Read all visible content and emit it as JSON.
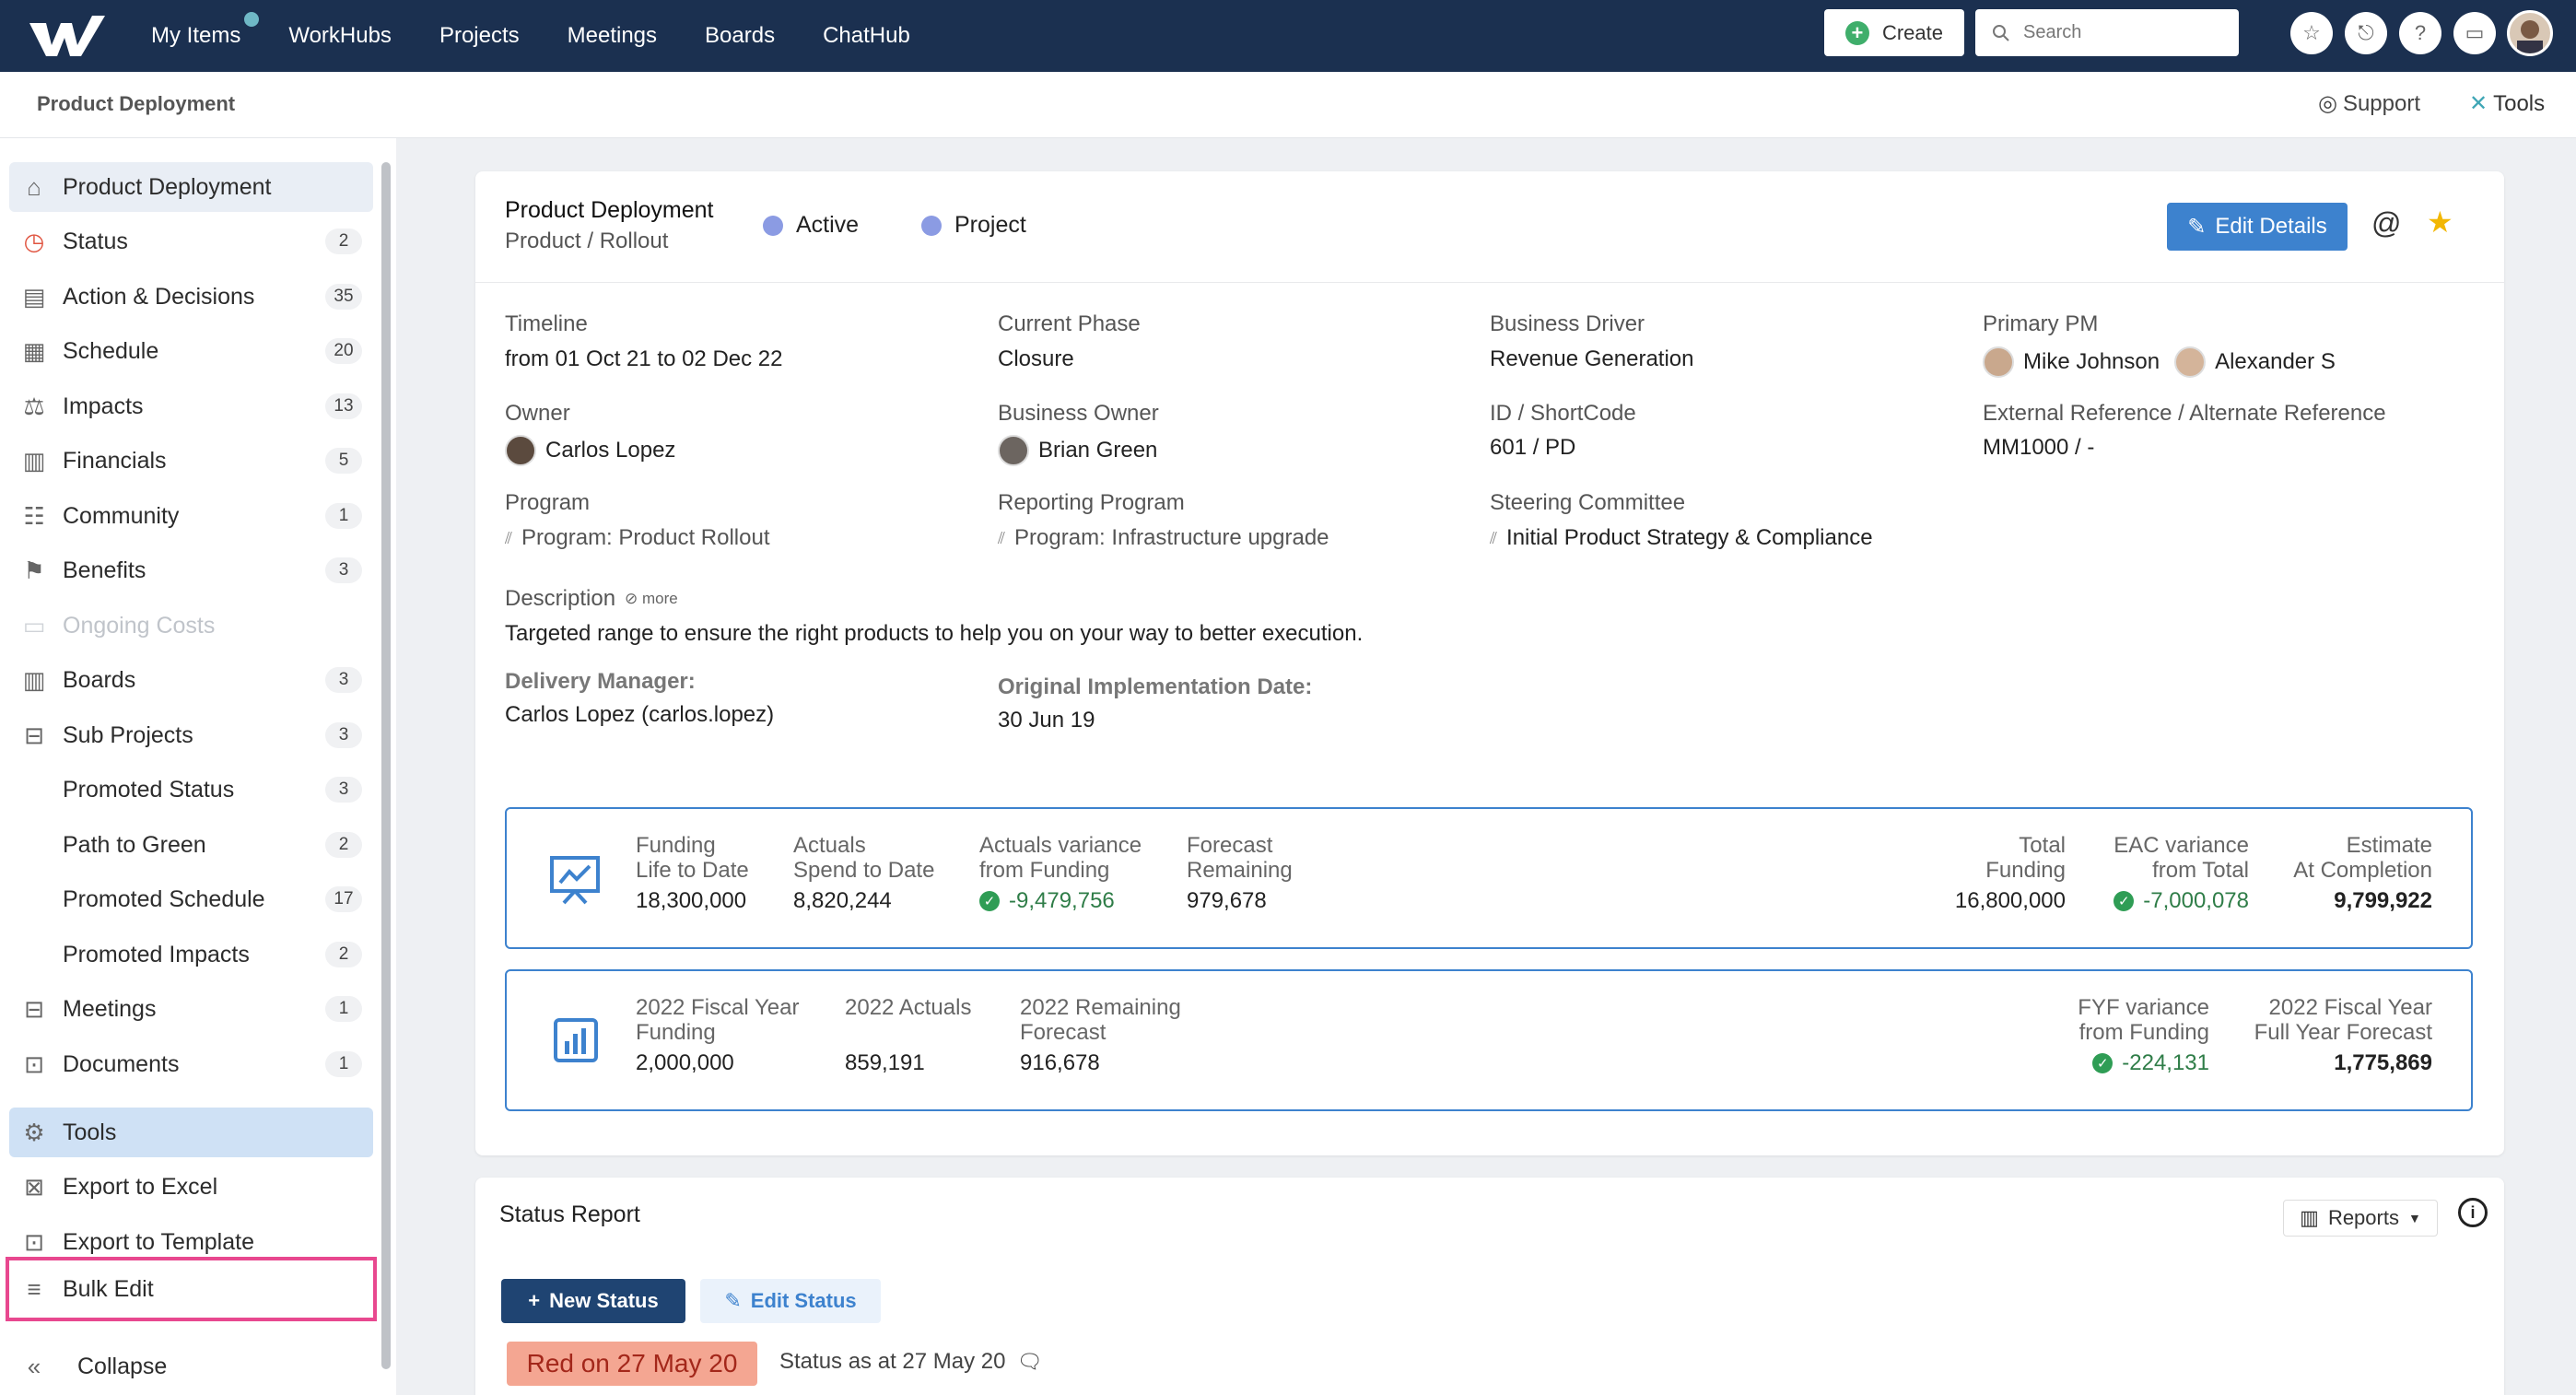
{
  "topnav": {
    "items": [
      "My Items",
      "WorkHubs",
      "Projects",
      "Meetings",
      "Boards",
      "ChatHub"
    ],
    "create_label": "Create",
    "search_placeholder": "Search"
  },
  "subheader": {
    "breadcrumb": "Product Deployment",
    "support_label": "Support",
    "tools_label": "Tools"
  },
  "sidebar": {
    "items": [
      {
        "label": "Product Deployment",
        "count": "",
        "icon": "home-icon"
      },
      {
        "label": "Status",
        "count": "2",
        "icon": "status-icon"
      },
      {
        "label": "Action & Decisions",
        "count": "35",
        "icon": "clipboard-icon"
      },
      {
        "label": "Schedule",
        "count": "20",
        "icon": "calendar-icon"
      },
      {
        "label": "Impacts",
        "count": "13",
        "icon": "scale-icon"
      },
      {
        "label": "Financials",
        "count": "5",
        "icon": "chart-icon"
      },
      {
        "label": "Community",
        "count": "1",
        "icon": "people-icon"
      },
      {
        "label": "Benefits",
        "count": "3",
        "icon": "flag-icon"
      },
      {
        "label": "Ongoing Costs",
        "count": "",
        "icon": "money-icon"
      },
      {
        "label": "Boards",
        "count": "3",
        "icon": "columns-icon"
      },
      {
        "label": "Sub Projects",
        "count": "3",
        "icon": "box-icon"
      },
      {
        "label": "Promoted Status",
        "count": "3",
        "icon": ""
      },
      {
        "label": "Path to Green",
        "count": "2",
        "icon": ""
      },
      {
        "label": "Promoted Schedule",
        "count": "17",
        "icon": ""
      },
      {
        "label": "Promoted Impacts",
        "count": "2",
        "icon": ""
      },
      {
        "label": "Meetings",
        "count": "1",
        "icon": "meeting-icon"
      },
      {
        "label": "Documents",
        "count": "1",
        "icon": "document-icon"
      },
      {
        "label": "Tools",
        "count": "",
        "icon": "gear-icon"
      },
      {
        "label": "Export to Excel",
        "count": "",
        "icon": "excel-icon"
      },
      {
        "label": "Export to Template",
        "count": "",
        "icon": "word-icon"
      },
      {
        "label": "Bulk Edit",
        "count": "",
        "icon": "bulk-edit-icon"
      }
    ],
    "collapse_label": "Collapse"
  },
  "project": {
    "title": "Product Deployment",
    "subtitle": "Product / Rollout",
    "state": "Active",
    "type": "Project",
    "edit_label": "Edit Details",
    "fields": {
      "timeline_label": "Timeline",
      "timeline_value": "from 01 Oct 21 to 02 Dec 22",
      "phase_label": "Current Phase",
      "phase_value": "Closure",
      "driver_label": "Business Driver",
      "driver_value": "Revenue Generation",
      "pm_label": "Primary PM",
      "pm_1": "Mike Johnson",
      "pm_2": "Alexander S",
      "owner_label": "Owner",
      "owner_value": "Carlos Lopez",
      "bowner_label": "Business Owner",
      "bowner_value": "Brian Green",
      "id_label": "ID / ShortCode",
      "id_value": "601 / PD",
      "extref_label": "External Reference / Alternate Reference",
      "extref_value": "MM1000 / -",
      "program_label": "Program",
      "program_value": "Program: Product Rollout",
      "rprogram_label": "Reporting Program",
      "rprogram_value": "Program: Infrastructure upgrade",
      "steering_label": "Steering Committee",
      "steering_value": "Initial Product Strategy & Compliance",
      "desc_label": "Description",
      "desc_more": "more",
      "desc_value": "Targeted range to ensure the right products to help you on your way to better execution.",
      "dm_label": "Delivery Manager:",
      "dm_value": "Carlos Lopez (carlos.lopez)",
      "oid_label": "Original Implementation Date:",
      "oid_value": "30 Jun 19"
    },
    "funding": {
      "f1_l1": "Funding",
      "f1_l2": "Life to Date",
      "f1_v": "18,300,000",
      "f2_l1": "Actuals",
      "f2_l2": "Spend to Date",
      "f2_v": "8,820,244",
      "f3_l1": "Actuals variance",
      "f3_l2": "from Funding",
      "f3_v": "-9,479,756",
      "f4_l1": "Forecast",
      "f4_l2": "Remaining",
      "f4_v": "979,678",
      "f5_l1": "Total",
      "f5_l2": "Funding",
      "f5_v": "16,800,000",
      "f6_l1": "EAC variance",
      "f6_l2": "from Total",
      "f6_v": "-7,000,078",
      "f7_l1": "Estimate",
      "f7_l2": "At Completion",
      "f7_v": "9,799,922"
    },
    "fiscal": {
      "g1_l1": "2022 Fiscal Year",
      "g1_l2": "Funding",
      "g1_v": "2,000,000",
      "g2_l1": "2022 Actuals",
      "g2_v": "859,191",
      "g3_l1": "2022 Remaining",
      "g3_l2": "Forecast",
      "g3_v": "916,678",
      "g4_l1": "FYF variance",
      "g4_l2": "from Funding",
      "g4_v": "-224,131",
      "g5_l1": "2022 Fiscal Year",
      "g5_l2": "Full Year Forecast",
      "g5_v": "1,775,869"
    }
  },
  "status_report": {
    "title": "Status Report",
    "reports_label": "Reports",
    "new_status": "New Status",
    "edit_status": "Edit Status",
    "red_badge": "Red on 27 May 20",
    "status_as": "Status as at 27 May 20"
  },
  "colors": {
    "nav_bg": "#1b3050",
    "accent": "#3d82ce",
    "highlight": "#e8488f",
    "green": "#2f7d48",
    "red_badge": "#f4a692"
  }
}
